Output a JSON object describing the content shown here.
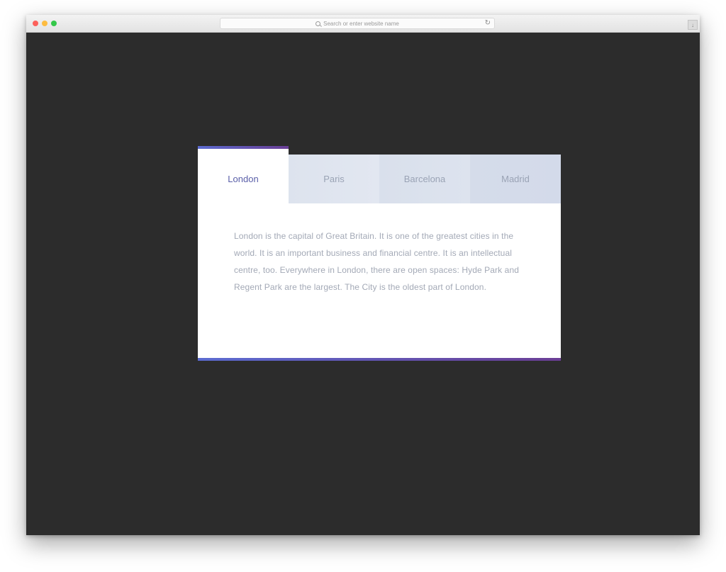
{
  "browser": {
    "address_placeholder": "Search or enter website name"
  },
  "tabs": [
    {
      "label": "London",
      "active": true
    },
    {
      "label": "Paris",
      "active": false
    },
    {
      "label": "Barcelona",
      "active": false
    },
    {
      "label": "Madrid",
      "active": false
    }
  ],
  "panel": {
    "text": "London is the capital of Great Britain. It is one of the greatest cities in the world. It is an important business and financial centre. It is an intellectual centre, too. Everywhere in London, there are open spaces: Hyde Park and Regent Park are the largest. The City is the oldest part of London."
  },
  "colors": {
    "page_background": "#2c2c2c",
    "accent_start": "#5b6bd0",
    "accent_end": "#6a3e95",
    "active_tab_text": "#5a5fa8",
    "inactive_tab_text": "#9aa3b5",
    "inactive_tab_bg": "#dfe5ef",
    "body_text": "#a3a9b6"
  },
  "icons": {
    "search": "search-icon",
    "reload": "reload-icon",
    "download": "download-icon"
  }
}
